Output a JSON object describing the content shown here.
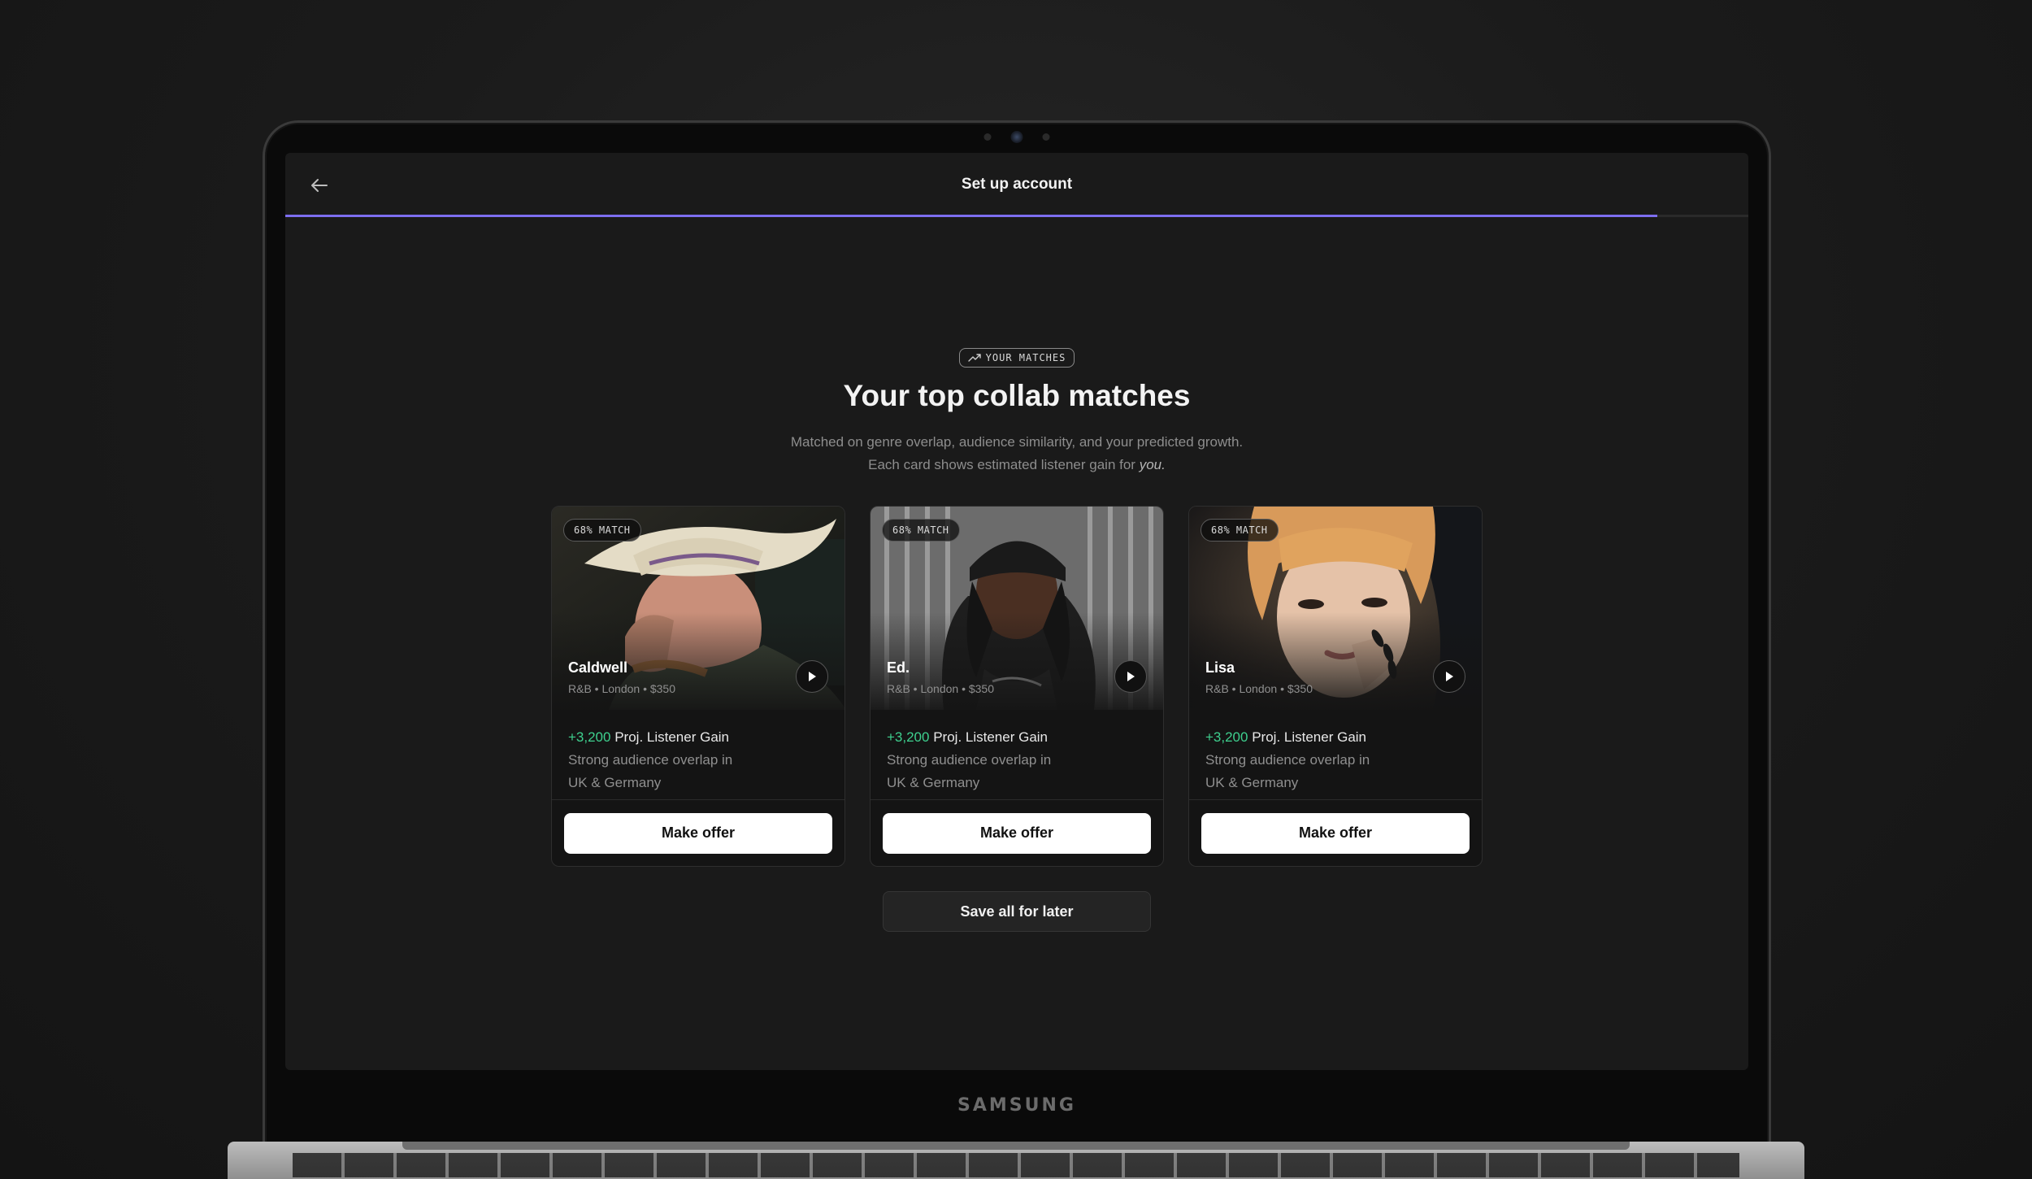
{
  "device": {
    "brand": "SAMSUNG"
  },
  "header": {
    "title": "Set up account",
    "progress": 0.938
  },
  "hero": {
    "tag": "YOUR MATCHES",
    "title": "Your top collab matches",
    "subtitle_line1": "Matched on genre overlap, audience similarity, and your predicted growth.",
    "subtitle_line2_prefix": "Each card shows estimated listener gain for ",
    "subtitle_line2_em": "you."
  },
  "cards": [
    {
      "badge": "68% MATCH",
      "name": "Caldwell",
      "meta": "R&B • London • $350",
      "gain_value": "+3,200",
      "gain_label": "Proj. Listener Gain",
      "description": "Strong audience overlap in UK & Germany",
      "button": "Make offer"
    },
    {
      "badge": "68% MATCH",
      "name": "Ed.",
      "meta": "R&B • London • $350",
      "gain_value": "+3,200",
      "gain_label": "Proj. Listener Gain",
      "description": "Strong audience overlap in UK & Germany",
      "button": "Make offer"
    },
    {
      "badge": "68% MATCH",
      "name": "Lisa",
      "meta": "R&B • London • $350",
      "gain_value": "+3,200",
      "gain_label": "Proj. Listener Gain",
      "description": "Strong audience overlap in UK & Germany",
      "button": "Make offer"
    }
  ],
  "actions": {
    "save_all": "Save all for later"
  },
  "colors": {
    "accent": "#7d6ef0",
    "gain": "#3ecf8e",
    "background": "#1a1a1a"
  }
}
